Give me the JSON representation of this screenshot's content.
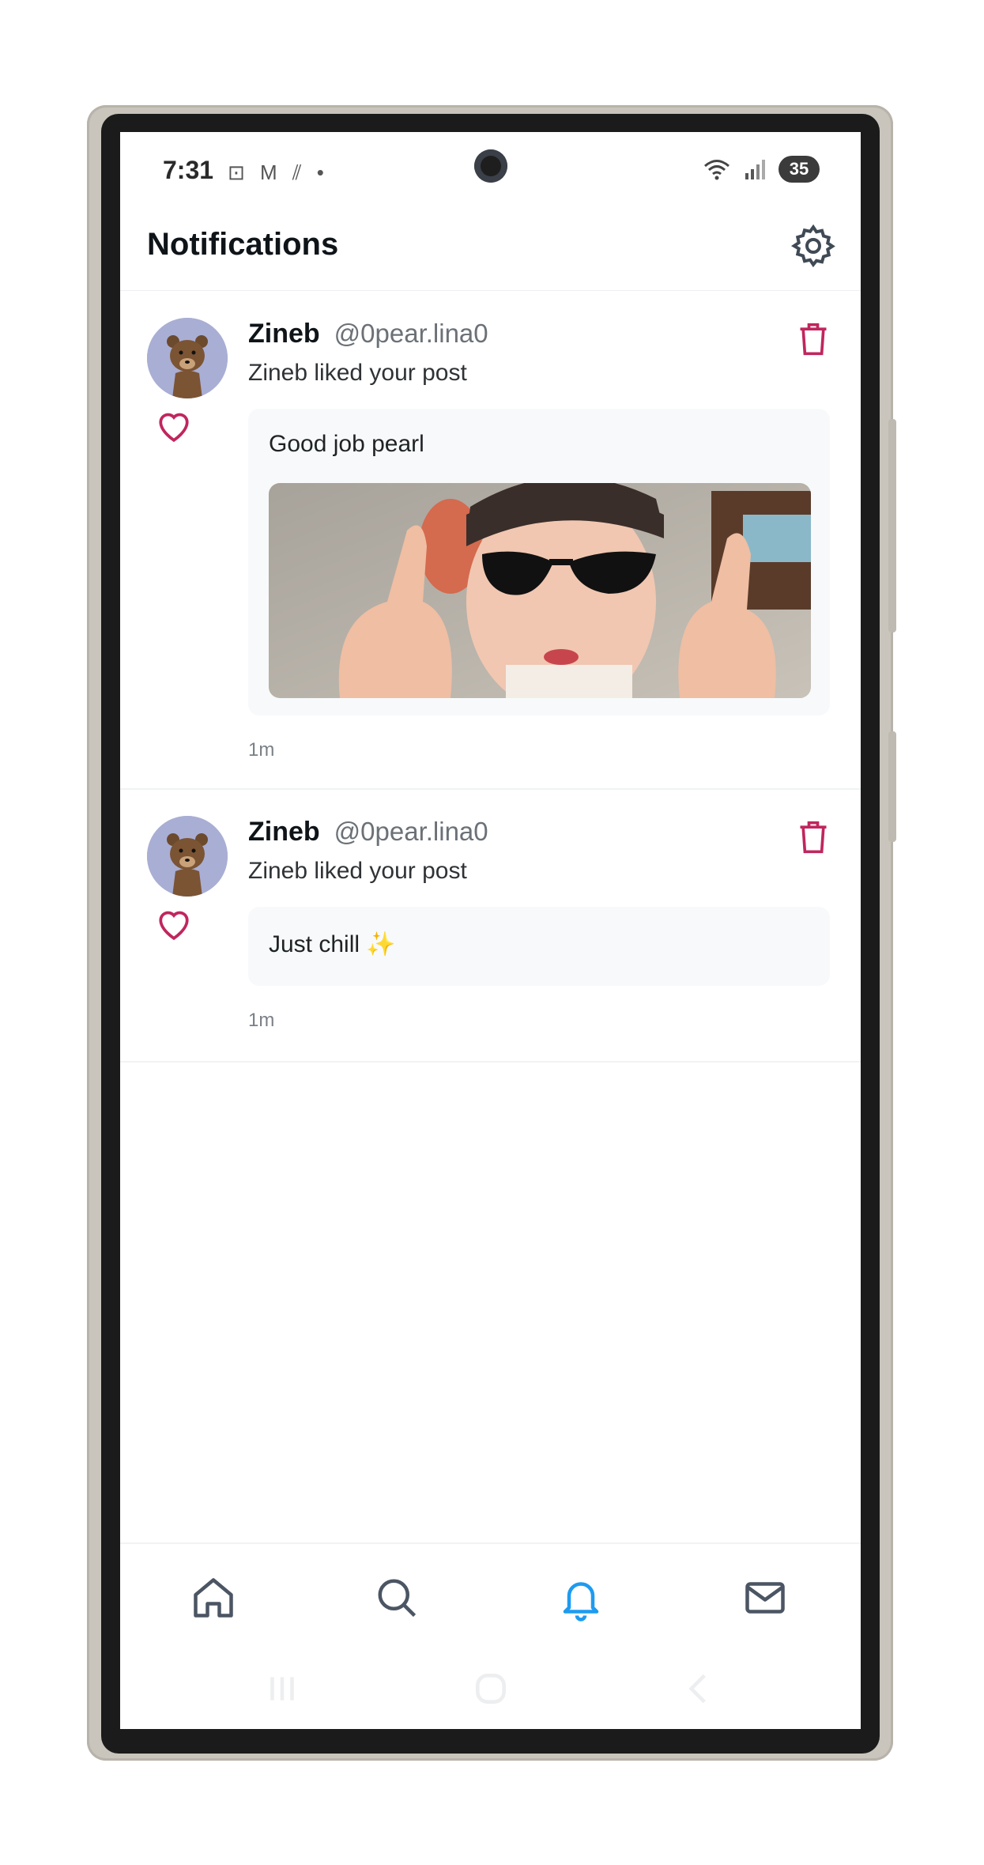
{
  "status_bar": {
    "time": "7:31",
    "left_icons": "⊡ M ⫽ •",
    "battery": "35"
  },
  "header": {
    "title": "Notifications"
  },
  "notifications": [
    {
      "name": "Zineb",
      "handle": "@0pear.lina0",
      "action": "Zineb  liked your post",
      "post_text": "Good job pearl",
      "has_image": true,
      "time": "1m"
    },
    {
      "name": "Zineb",
      "handle": "@0pear.lina0",
      "action": "Zineb  liked your post",
      "post_text": "Just chill ✨",
      "has_image": false,
      "time": "1m"
    }
  ],
  "bottom_nav": {
    "items": [
      "home-icon",
      "search-icon",
      "bell-icon",
      "mail-icon"
    ],
    "active": "bell-icon"
  },
  "colors": {
    "accent": "#1d9bf0",
    "like": "#c0265e",
    "delete": "#c0265e",
    "nav_icon": "#4b5563"
  }
}
